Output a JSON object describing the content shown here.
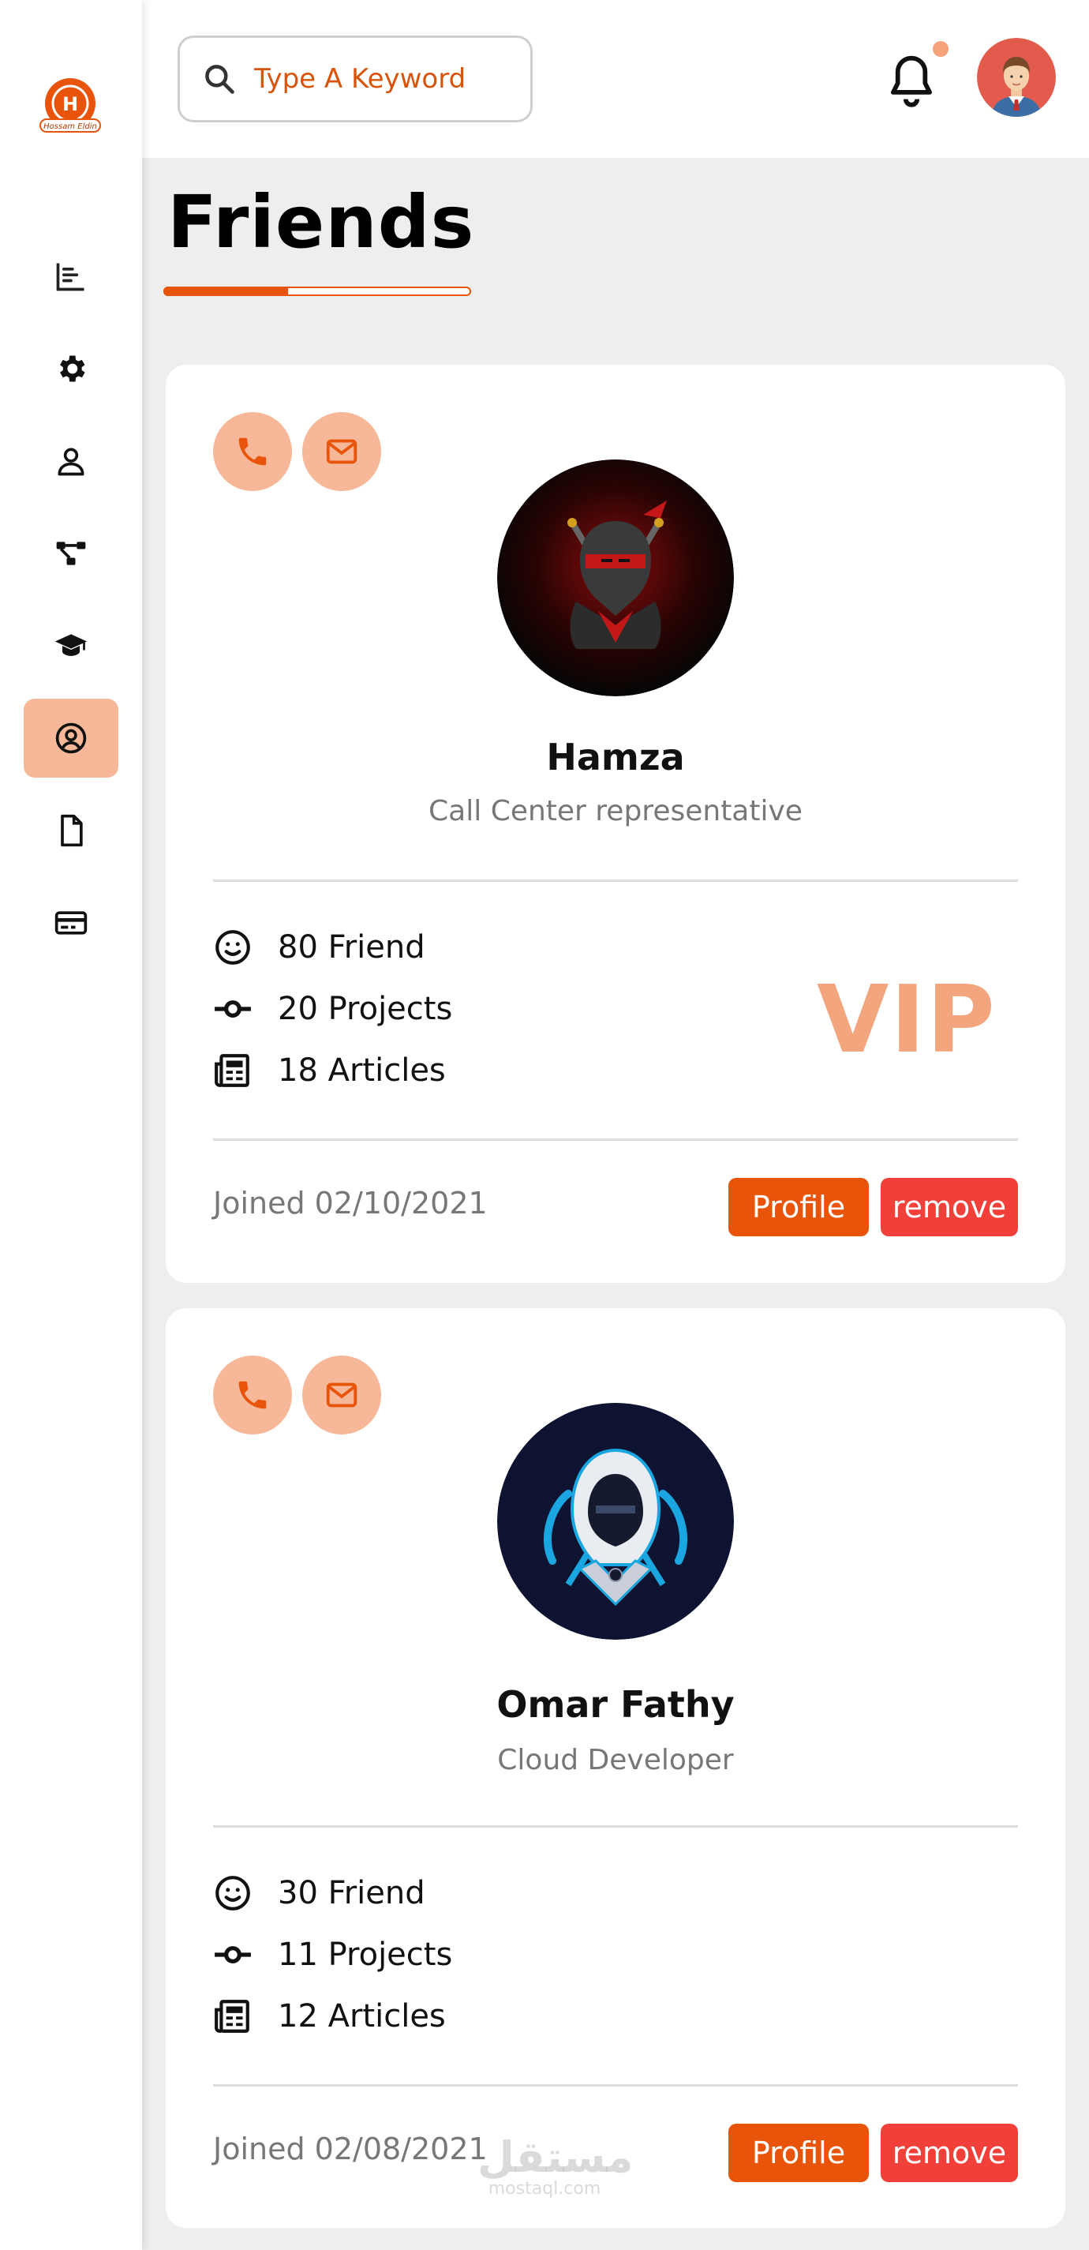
{
  "brand": {
    "logo_text": "Hossam Eldin",
    "accent": "#e8540a",
    "accent_light": "#f6b898"
  },
  "sidebar": {
    "items": [
      {
        "name": "dashboard",
        "icon": "chart-simple-icon"
      },
      {
        "name": "settings",
        "icon": "gear-icon"
      },
      {
        "name": "profile",
        "icon": "user-icon"
      },
      {
        "name": "projects",
        "icon": "diagram-project-icon"
      },
      {
        "name": "courses",
        "icon": "graduation-cap-icon"
      },
      {
        "name": "friends",
        "icon": "circle-user-icon",
        "active": true
      },
      {
        "name": "files",
        "icon": "file-icon"
      },
      {
        "name": "plans",
        "icon": "credit-card-icon"
      }
    ]
  },
  "header": {
    "search_placeholder": "Type A Keyword",
    "notification_icon": "bell-icon",
    "avatar_icon": "user-avatar"
  },
  "page": {
    "title": "Friends"
  },
  "friends": [
    {
      "name": "Hamza",
      "role": "Call Center representative",
      "stats": [
        {
          "icon": "face-smile-icon",
          "text": "80 Friend"
        },
        {
          "icon": "code-commit-icon",
          "text": "20 Projects"
        },
        {
          "icon": "newspaper-icon",
          "text": "18 Articles"
        }
      ],
      "badge": "VIP",
      "joined": "Joined 02/10/2021",
      "profile_label": "Profile",
      "remove_label": "remove"
    },
    {
      "name": "Omar Fathy",
      "role": "Cloud Developer",
      "stats": [
        {
          "icon": "face-smile-icon",
          "text": "30 Friend"
        },
        {
          "icon": "code-commit-icon",
          "text": "11 Projects"
        },
        {
          "icon": "newspaper-icon",
          "text": "12 Articles"
        }
      ],
      "joined": "Joined 02/08/2021",
      "profile_label": "Profile",
      "remove_label": "remove"
    }
  ],
  "watermark": {
    "arabic": "مستقل",
    "latin": "mostaql.com"
  }
}
